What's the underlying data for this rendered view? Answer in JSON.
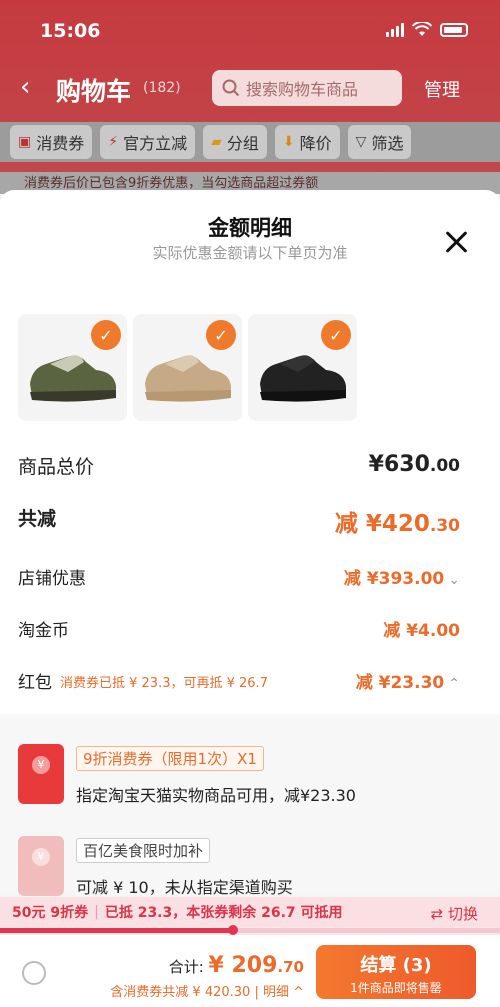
{
  "status_bar": {
    "time": "15:06"
  },
  "header": {
    "title": "购物车",
    "count": "(182)",
    "search_placeholder": "搜索购物车商品",
    "manage_label": "管理"
  },
  "filters": [
    {
      "label": "消费券",
      "icon": "coupon-icon"
    },
    {
      "label": "官方立减",
      "icon": "lightning-icon"
    },
    {
      "label": "分组",
      "icon": "folder-icon"
    },
    {
      "label": "降价",
      "icon": "down-arrow-icon"
    },
    {
      "label": "筛选",
      "icon": "filter-icon"
    }
  ],
  "coupon_hint": "消费券后价已包含9折券优惠，当勾选商品超过券额",
  "sheet": {
    "title": "金额明细",
    "subtitle": "实际优惠金额请以下单页为准",
    "products": [
      {
        "name": "olive-sneaker",
        "color": "#4f5a3a"
      },
      {
        "name": "beige-sneaker",
        "color": "#c7ad8c"
      },
      {
        "name": "black-sneaker",
        "color": "#1c1c1c"
      }
    ],
    "rows": {
      "total": {
        "label": "商品总价",
        "value_main": "¥630",
        "value_dec": ".00"
      },
      "reduce": {
        "label": "共减",
        "value_main": "减 ¥420",
        "value_dec": ".30"
      },
      "shop": {
        "label": "店铺优惠",
        "value": "减 ¥393.00"
      },
      "coin": {
        "label": "淘金币",
        "value": "减 ¥4.00"
      },
      "hongbao": {
        "label": "红包",
        "note": "消费券已抵 ¥ 23.3，可再抵 ¥ 26.7",
        "value": "减 ¥23.30"
      }
    },
    "coupons": [
      {
        "tag": "9折消费券（限用1次）X1",
        "desc": "指定淘宝天猫实物商品可用，减¥23.30"
      },
      {
        "tag": "百亿美食限时加补",
        "desc": "可减 ¥ 10，未从指定渠道购买"
      }
    ]
  },
  "savings_strip": {
    "part1": "50元 9折券",
    "part2": "已抵 23.3，本张券剩余 26.7 可抵用",
    "switch_label": "⇄ 切换",
    "progress": 0.466
  },
  "footer": {
    "total_label": "合计:",
    "total_main": "¥ 209",
    "total_dec": ".70",
    "breakdown": "含消费券共减 ¥ 420.30 | 明细 ^",
    "checkout_label": "结算 (3)",
    "checkout_sub": "1件商品即将售罄"
  },
  "colors": {
    "accent": "#ea6b2a",
    "header_red": "#c63a3f",
    "strip_red": "#d8344a"
  }
}
